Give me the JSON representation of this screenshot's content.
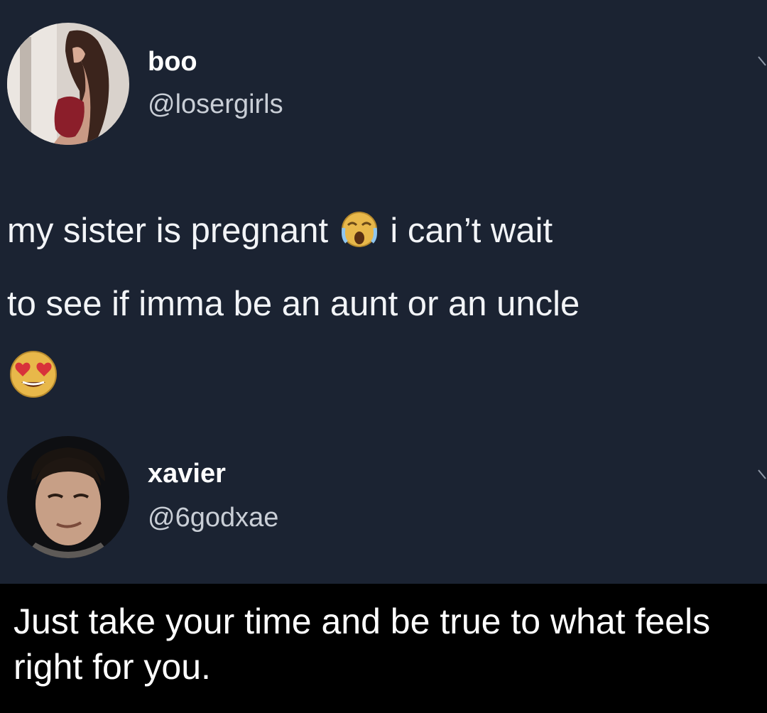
{
  "tweet1": {
    "display_name": "boo",
    "handle": "@losergirls",
    "text_line1_a": "my sister is pregnant",
    "text_line1_b": "i can’t wait",
    "text_line2": "to see if imma be an aunt or an uncle",
    "emoji1": "crying-face-emoji",
    "emoji2": "heart-eyes-emoji"
  },
  "tweet2": {
    "display_name": "xavier",
    "handle": "@6godxae"
  },
  "caption": {
    "text": "Just take your time and be true to what feels right for you."
  },
  "colors": {
    "background": "#1b2332",
    "caption_background": "#000000",
    "text": "#ffffff",
    "handle": "#c9ced6"
  }
}
